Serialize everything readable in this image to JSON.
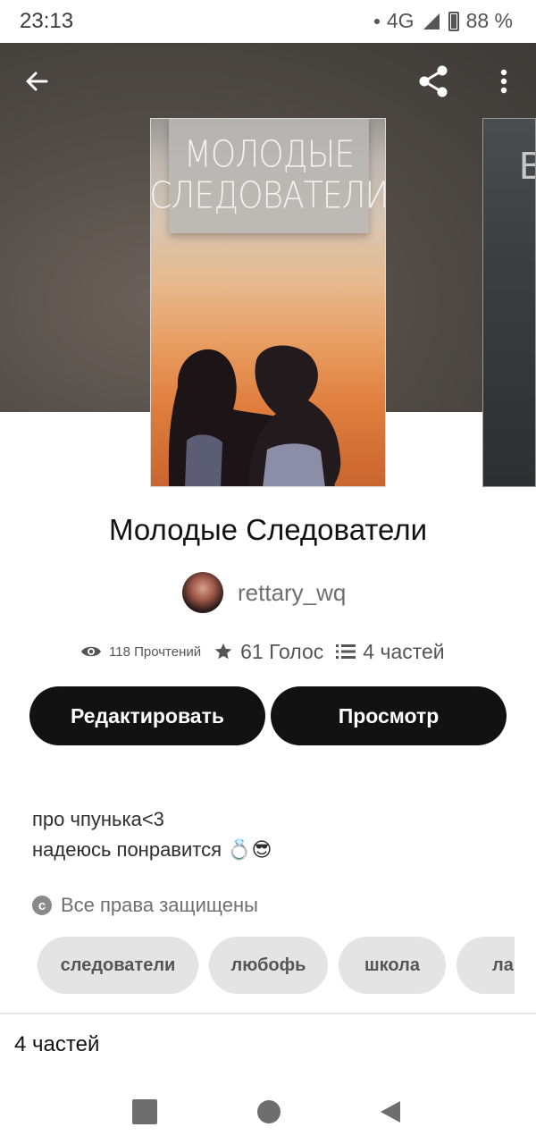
{
  "status_bar": {
    "time": "23:13",
    "network": "4G",
    "battery": "88 %"
  },
  "header": {
    "back_icon": "arrow-left-icon",
    "share_icon": "share-icon",
    "more_icon": "more-vertical-icon"
  },
  "cover": {
    "title_line1": "МОЛОДЫЕ",
    "title_line2": "СЛЕДОВАТЕЛИ",
    "next_cover_letter": "В"
  },
  "story": {
    "title": "Молодые Следователи",
    "author": "rettary_wq"
  },
  "stats": {
    "reads": "118 Прочтений",
    "votes": "61 Голос",
    "parts": "4 частей"
  },
  "actions": {
    "edit_label": "Редактировать",
    "view_label": "Просмотр"
  },
  "description": {
    "line1": "про чпунька<3",
    "line2": "надеюсь понравится 💍😎"
  },
  "rights": {
    "icon": "c",
    "label": "Все права защищены"
  },
  "tags": [
    "следователи",
    "любофь",
    "школа",
    "ла"
  ],
  "parts_section": {
    "heading": "4 частей"
  },
  "colors": {
    "button_bg": "#121212",
    "header_bg": "#4d4843",
    "tag_bg": "#e4e4e4"
  }
}
